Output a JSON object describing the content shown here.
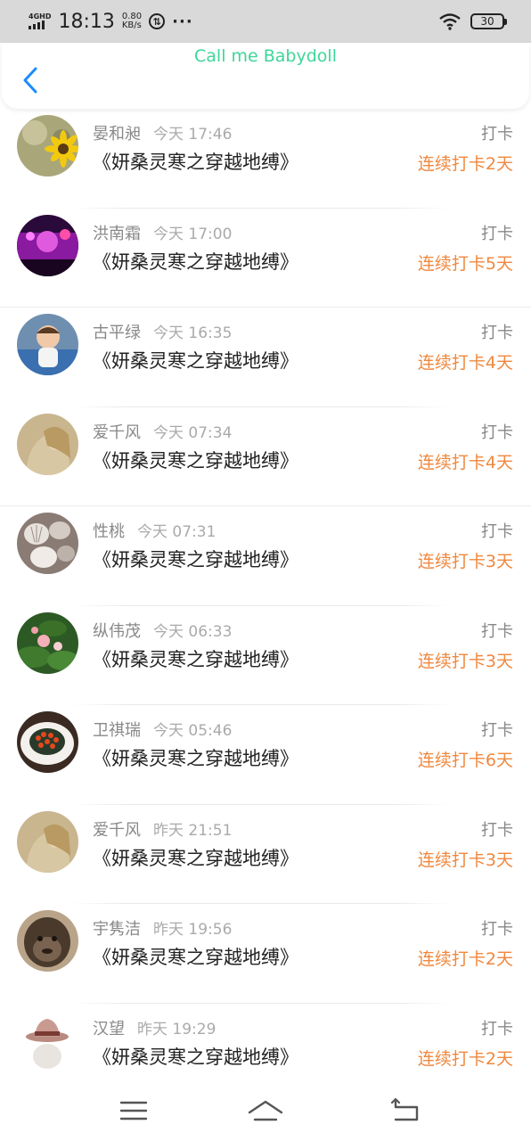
{
  "status_bar": {
    "network_type": "4GHD",
    "time": "18:13",
    "speed_value": "0.80",
    "speed_unit": "KB/s",
    "battery": "30",
    "icons": [
      "signal-icon",
      "sync-icon",
      "more-dots-icon",
      "wifi-icon",
      "battery-icon"
    ]
  },
  "header": {
    "title": "Call me Babydoll",
    "title_color": "#3ed69a",
    "back_icon": "chevron-left-icon",
    "accent": "#1a8cff"
  },
  "colors": {
    "streak": "#f0883e",
    "name": "#888888",
    "title": "#222222"
  },
  "items": [
    {
      "name": "晏和昶",
      "time": "今天 17:46",
      "title": "《妍桑灵寒之穿越地缚》",
      "tag": "打卡",
      "streak": "连续打卡2天",
      "avatar": "sunflower-avatar"
    },
    {
      "name": "洪南霜",
      "time": "今天 17:00",
      "title": "《妍桑灵寒之穿越地缚》",
      "tag": "打卡",
      "streak": "连续打卡5天",
      "avatar": "concert-avatar"
    },
    {
      "name": "古平绿",
      "time": "今天 16:35",
      "title": "《妍桑灵寒之穿越地缚》",
      "tag": "打卡",
      "streak": "连续打卡4天",
      "avatar": "baby-avatar"
    },
    {
      "name": "爱千风",
      "time": "今天 07:34",
      "title": "《妍桑灵寒之穿越地缚》",
      "tag": "打卡",
      "streak": "连续打卡4天",
      "avatar": "girl-avatar"
    },
    {
      "name": "性桃",
      "time": "今天 07:31",
      "title": "《妍桑灵寒之穿越地缚》",
      "tag": "打卡",
      "streak": "连续打卡3天",
      "avatar": "shells-avatar"
    },
    {
      "name": "纵伟茂",
      "time": "今天 06:33",
      "title": "《妍桑灵寒之穿越地缚》",
      "tag": "打卡",
      "streak": "连续打卡3天",
      "avatar": "lotus-avatar"
    },
    {
      "name": "卫祺瑞",
      "time": "今天 05:46",
      "title": "《妍桑灵寒之穿越地缚》",
      "tag": "打卡",
      "streak": "连续打卡6天",
      "avatar": "dish-avatar"
    },
    {
      "name": "爱千风",
      "time": "昨天 21:51",
      "title": "《妍桑灵寒之穿越地缚》",
      "tag": "打卡",
      "streak": "连续打卡3天",
      "avatar": "girl-avatar"
    },
    {
      "name": "宇隽洁",
      "time": "昨天 19:56",
      "title": "《妍桑灵寒之穿越地缚》",
      "tag": "打卡",
      "streak": "连续打卡2天",
      "avatar": "ape-avatar"
    },
    {
      "name": "汉望",
      "time": "昨天 19:29",
      "title": "《妍桑灵寒之穿越地缚》",
      "tag": "打卡",
      "streak": "连续打卡2天",
      "avatar": "hat-avatar"
    }
  ],
  "nav_bar": {
    "icons": [
      "menu-icon",
      "home-icon",
      "back-icon"
    ]
  }
}
